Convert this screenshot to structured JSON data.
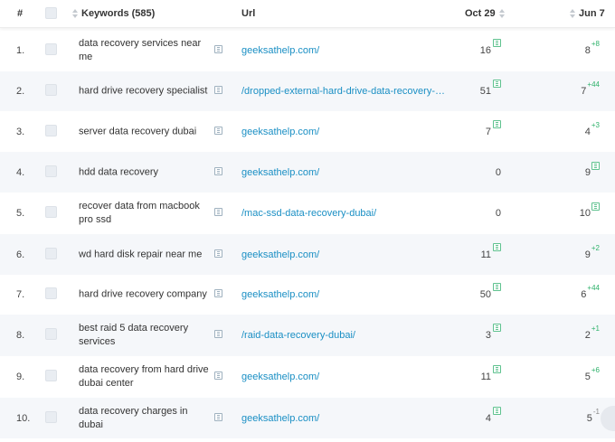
{
  "header": {
    "num": "#",
    "keywords": "Keywords (585)",
    "url": "Url",
    "col1": "Oct 29",
    "col2": "Jun 7"
  },
  "rows": [
    {
      "num": "1.",
      "keyword": "data recovery services near me",
      "url": "geeksathelp.com/",
      "oct": "16",
      "jun": "8",
      "change": "+8"
    },
    {
      "num": "2.",
      "keyword": "hard drive recovery specialist",
      "url": "/dropped-external-hard-drive-data-recovery-…",
      "oct": "51",
      "jun": "7",
      "change": "+44"
    },
    {
      "num": "3.",
      "keyword": "server data recovery dubai",
      "url": "geeksathelp.com/",
      "oct": "7",
      "jun": "4",
      "change": "+3"
    },
    {
      "num": "4.",
      "keyword": "hdd data recovery",
      "url": "geeksathelp.com/",
      "oct": "0",
      "jun": "9",
      "change": ""
    },
    {
      "num": "5.",
      "keyword": "recover data from macbook pro ssd",
      "url": "/mac-ssd-data-recovery-dubai/",
      "oct": "0",
      "jun": "10",
      "change": ""
    },
    {
      "num": "6.",
      "keyword": "wd hard disk repair near me",
      "url": "geeksathelp.com/",
      "oct": "11",
      "jun": "9",
      "change": "+2"
    },
    {
      "num": "7.",
      "keyword": "hard drive recovery company",
      "url": "geeksathelp.com/",
      "oct": "50",
      "jun": "6",
      "change": "+44"
    },
    {
      "num": "8.",
      "keyword": "best raid 5 data recovery services",
      "url": "/raid-data-recovery-dubai/",
      "oct": "3",
      "jun": "2",
      "change": "+1"
    },
    {
      "num": "9.",
      "keyword": "data recovery from hard drive dubai center",
      "url": "geeksathelp.com/",
      "oct": "11",
      "jun": "5",
      "change": "+6"
    },
    {
      "num": "10.",
      "keyword": "data recovery charges in dubai",
      "url": "geeksathelp.com/",
      "oct": "4",
      "jun": "5",
      "change": "-1"
    }
  ],
  "colors": {
    "link": "#1a8fc4",
    "positive": "#2fb26b",
    "stripe": "#f5f7fa"
  },
  "icons": {
    "sort": "sort-icon",
    "history": "position-history-icon",
    "serp": "serp-preview-icon"
  }
}
